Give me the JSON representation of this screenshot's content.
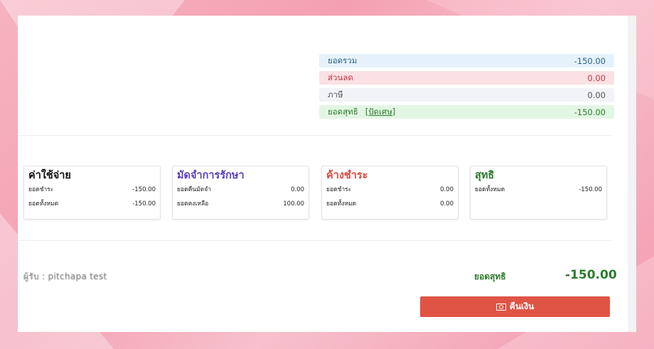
{
  "summary": {
    "total": {
      "label": "ยอดรวม",
      "value": "-150.00"
    },
    "discount": {
      "label": "ส่วนลด",
      "value": "0.00"
    },
    "tax": {
      "label": "ภาษี",
      "value": "0.00"
    },
    "net": {
      "label": "ยอดสุทธิ",
      "link": "[ปัดเศษ]",
      "value": "-150.00"
    }
  },
  "cards": {
    "expense": {
      "title": "ค่าใช้จ่าย",
      "rows": [
        {
          "label": "ยอดชำระ",
          "value": "-150.00"
        },
        {
          "label": "ยอดทั้งหมด",
          "value": "-150.00"
        }
      ]
    },
    "deposit": {
      "title": "มัดจำการรักษา",
      "rows": [
        {
          "label": "ยอดคืนมัดจำ",
          "value": "0.00"
        },
        {
          "label": "ยอดคงเหลือ",
          "value": "100.00"
        }
      ]
    },
    "outstanding": {
      "title": "ค้างชำระ",
      "rows": [
        {
          "label": "ยอดชำระ",
          "value": "0.00"
        },
        {
          "label": "ยอดทั้งหมด",
          "value": "0.00"
        }
      ]
    },
    "net": {
      "title": "สุทธิ",
      "rows": [
        {
          "label": "ยอดทั้งหมด",
          "value": "-150.00"
        }
      ]
    }
  },
  "footer": {
    "receiver": "ผู้รับ : pitchapa test",
    "net_label": "ยอดสุทธิ",
    "net_value": "-150.00",
    "refund_button": "คืนเงิน",
    "refund_icon": "money-icon"
  },
  "colors": {
    "refund": "#e05445",
    "net": "#2d7a2d",
    "deposit": "#5a3fbf",
    "outstanding": "#e0483d"
  }
}
